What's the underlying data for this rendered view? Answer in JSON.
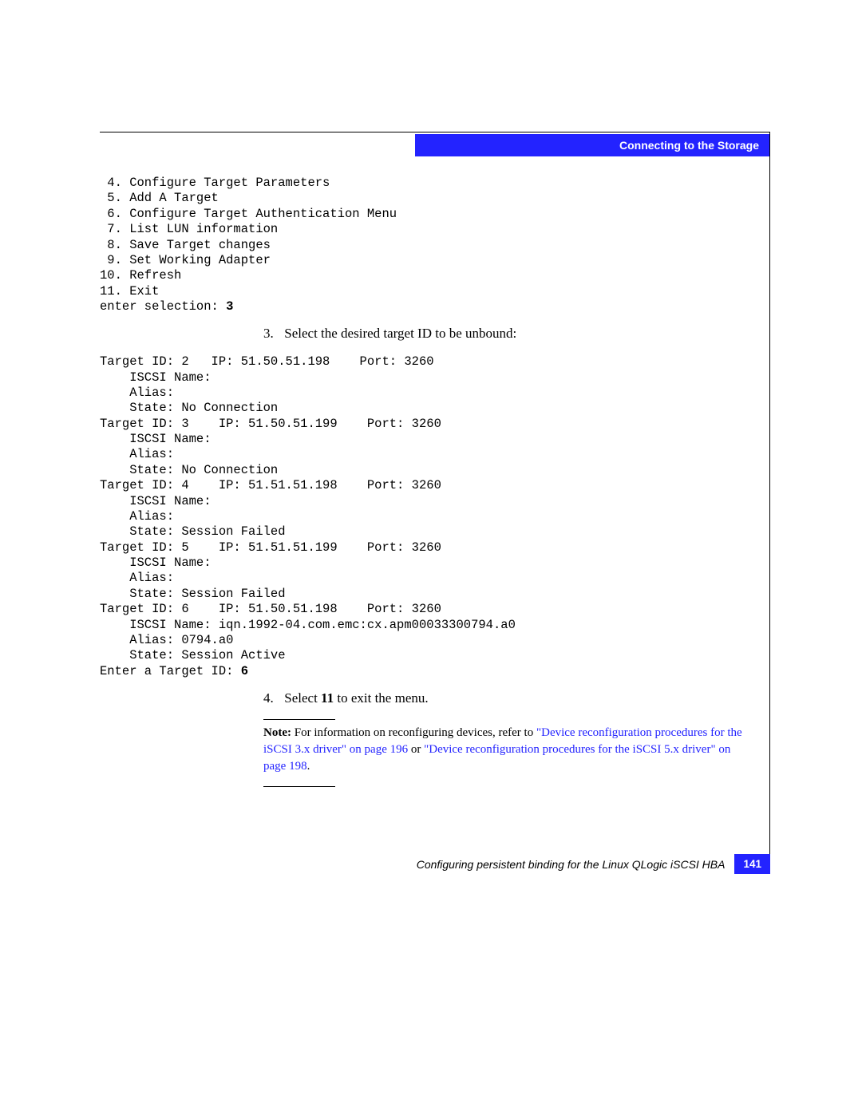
{
  "header": {
    "section_title": "Connecting to the Storage"
  },
  "menu_block": " 4. Configure Target Parameters\n 5. Add A Target\n 6. Configure Target Authentication Menu\n 7. List LUN information\n 8. Save Target changes\n 9. Set Working Adapter\n10. Refresh\n11. Exit\nenter selection: ",
  "menu_selection": "3",
  "step3": {
    "num": "3.",
    "text": "Select the desired target ID to be unbound:"
  },
  "target_block": "Target ID: 2   IP: 51.50.51.198    Port: 3260\n    ISCSI Name:\n    Alias:\n    State: No Connection\nTarget ID: 3    IP: 51.50.51.199    Port: 3260\n    ISCSI Name:\n    Alias:\n    State: No Connection\nTarget ID: 4    IP: 51.51.51.198    Port: 3260\n    ISCSI Name:\n    Alias:\n    State: Session Failed\nTarget ID: 5    IP: 51.51.51.199    Port: 3260\n    ISCSI Name:\n    Alias:\n    State: Session Failed\nTarget ID: 6    IP: 51.50.51.198    Port: 3260\n    ISCSI Name: iqn.1992-04.com.emc:cx.apm00033300794.a0\n    Alias: 0794.a0\n    State: Session Active\nEnter a Target ID: ",
  "target_selection": "6",
  "step4": {
    "num": "4.",
    "prefix": "Select ",
    "bold": "11",
    "suffix": " to exit the menu."
  },
  "note": {
    "label": "Note:",
    "t1": " For information on reconfiguring devices, refer to ",
    "link1": "\"Device reconfiguration procedures for the iSCSI 3.x driver\" on page 196",
    "t2": " or ",
    "link2": "\"Device reconfiguration procedures for the iSCSI 5.x driver\" on page 198",
    "t3": "."
  },
  "footer": {
    "text": "Configuring persistent binding for the Linux QLogic iSCSI HBA",
    "page": "141"
  }
}
